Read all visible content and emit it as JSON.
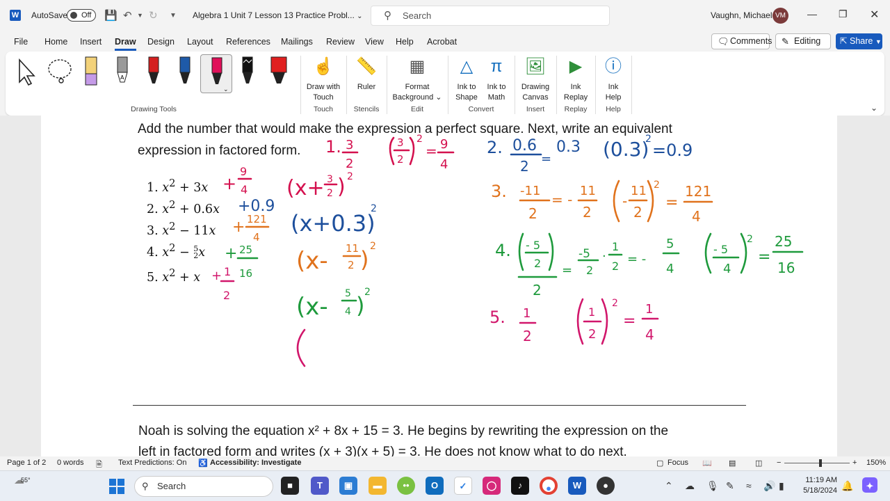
{
  "titlebar": {
    "autosave_label": "AutoSave",
    "autosave_state": "Off",
    "doc_title": "Algebra 1 Unit 7 Lesson 13 Practice Probl...",
    "search_placeholder": "Search",
    "user_name": "Vaughn, Michael",
    "user_initials": "VM"
  },
  "menu": {
    "items": [
      "File",
      "Home",
      "Insert",
      "Draw",
      "Design",
      "Layout",
      "References",
      "Mailings",
      "Review",
      "View",
      "Help",
      "Acrobat"
    ],
    "active": "Draw",
    "comments": "Comments",
    "editing": "Editing",
    "share": "Share"
  },
  "ribbon": {
    "groups": {
      "drawing_tools": "Drawing Tools",
      "touch": "Touch",
      "stencils": "Stencils",
      "edit": "Edit",
      "convert": "Convert",
      "insert": "Insert",
      "replay": "Replay",
      "help": "Help"
    },
    "buttons": {
      "draw_touch_1": "Draw with",
      "draw_touch_2": "Touch",
      "ruler": "Ruler",
      "format_bg_1": "Format",
      "format_bg_2": "Background",
      "ink_shape_1": "Ink to",
      "ink_shape_2": "Shape",
      "ink_math_1": "Ink to",
      "ink_math_2": "Math",
      "canvas_1": "Drawing",
      "canvas_2": "Canvas",
      "replay_1": "Ink",
      "replay_2": "Replay",
      "help_1": "Ink",
      "help_2": "Help"
    },
    "pen_colors": [
      "#f3d27a",
      "#9a9a9a",
      "#d42020",
      "#1e5aa8",
      "#e0105a",
      "#111111",
      "#e02020"
    ]
  },
  "document": {
    "instruction_1": "Add the number that would make the expression a perfect square. Next, write an equivalent",
    "instruction_2": "expression in factored form.",
    "problems": [
      "1.",
      "2.",
      "3.",
      "4.",
      "5."
    ],
    "noah_1": "Noah is solving the equation x² + 8x + 15 = 3. He begins by rewriting the expression on the",
    "noah_2": "left in factored form and writes (x + 3)(x + 5) = 3. He does not know what to do next."
  },
  "ink_colors": {
    "red": "#d4104e",
    "blue": "#1d4f9c",
    "orange": "#e0721c",
    "green": "#1e9a3c",
    "pink": "#d1166b"
  },
  "status": {
    "page": "Page 1 of 2",
    "words": "0 words",
    "predictions": "Text Predictions: On",
    "accessibility": "Accessibility: Investigate",
    "focus": "Focus",
    "zoom": "150%"
  },
  "taskbar": {
    "weather": "55°",
    "search": "Search",
    "time": "11:19 AM",
    "date": "5/18/2024"
  }
}
